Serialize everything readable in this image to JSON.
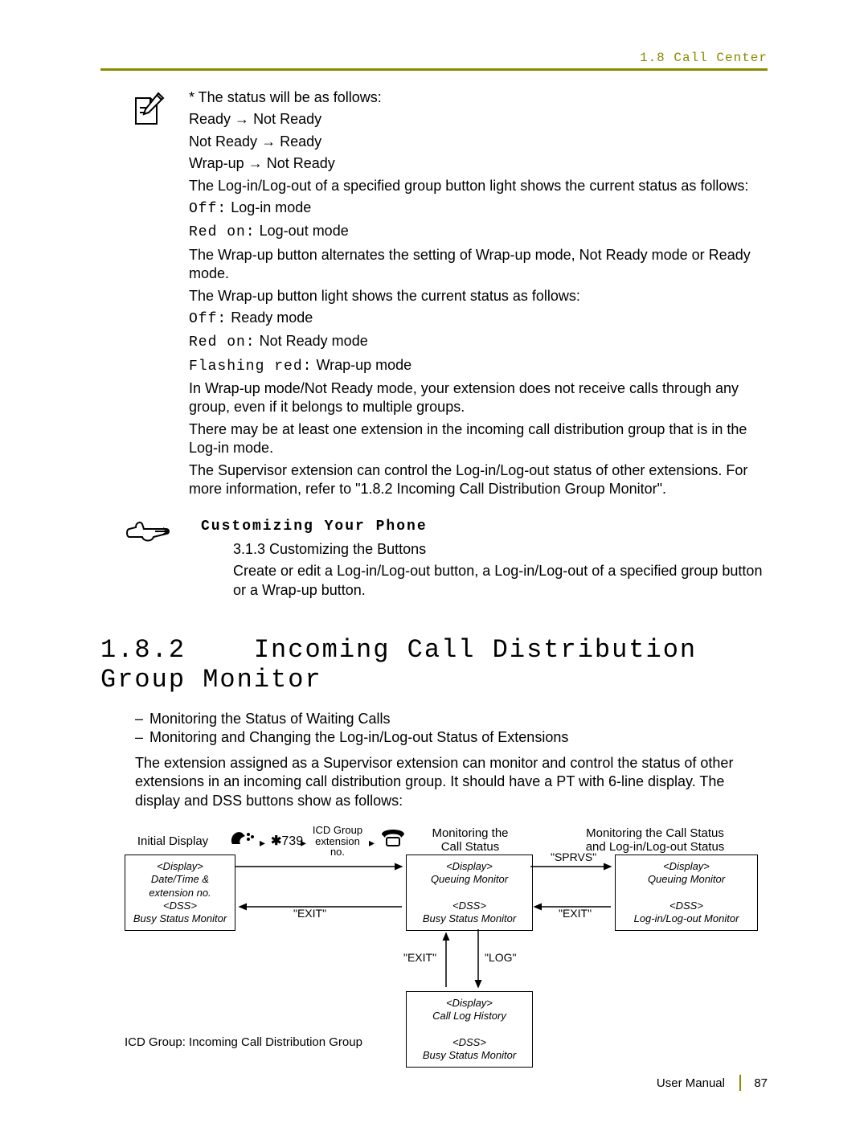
{
  "header": "1.8 Call Center",
  "note_block": {
    "status_intro": "* The status will be as follows:",
    "trans1_a": "Ready",
    "trans1_b": "Not Ready",
    "trans2_a": "Not Ready",
    "trans2_b": "Ready",
    "trans3_a": "Wrap-up",
    "trans3_b": "Not Ready",
    "p1": "The Log-in/Log-out of a specified group button light shows the current status as follows:",
    "off1_k": "Off:",
    "off1_v": "Log-in mode",
    "redon1_k": "Red on:",
    "redon1_v": "Log-out mode",
    "p2": "The Wrap-up button alternates the setting of Wrap-up mode, Not Ready mode or Ready mode.",
    "p3": "The Wrap-up button light shows the current status as follows:",
    "off2_k": "Off:",
    "off2_v": "Ready mode",
    "redon2_k": "Red on:",
    "redon2_v": "Not Ready mode",
    "flash_k": "Flashing red:",
    "flash_v": "Wrap-up mode",
    "p4": "In Wrap-up mode/Not Ready mode, your extension does not receive calls through any group, even if it belongs to multiple groups.",
    "p5": "There may be at least one extension in the incoming call distribution group that is in the Log-in mode.",
    "p6": "The Supervisor extension can control the Log-in/Log-out status of other extensions. For more information, refer to \"1.8.2 Incoming Call Distribution Group Monitor\"."
  },
  "custom": {
    "title": "Customizing Your Phone",
    "line1": "3.1.3 Customizing the Buttons",
    "line2": "Create or edit a Log-in/Log-out button, a Log-in/Log-out of a specified group button or a Wrap-up button."
  },
  "section": {
    "num": "1.8.2",
    "title": "Incoming Call Distribution Group Monitor",
    "bullets": [
      "Monitoring the Status of Waiting Calls",
      "Monitoring and Changing the Log-in/Log-out Status of Extensions"
    ],
    "para": "The extension assigned as a Supervisor extension can monitor and control the status of other extensions in an incoming call distribution group. It should have a PT with 6-line display. The display and DSS buttons show as follows:"
  },
  "flow": {
    "top": {
      "initial": "Initial Display",
      "code": "739",
      "ext": "ICD Group\nextension\nno.",
      "mid": "Monitoring the\nCall Status",
      "right": "Monitoring the Call Status\nand Log-in/Log-out Status"
    },
    "box_left": "<Display>\nDate/Time &\nextension no.\n<DSS>\nBusy Status Monitor",
    "box_mid": "<Display>\nQueuing Monitor\n\n<DSS>\nBusy Status Monitor",
    "box_right": "<Display>\nQueuing Monitor\n\n<DSS>\nLog-in/Log-out Monitor",
    "box_bottom": "<Display>\nCall Log History\n\n<DSS>\nBusy Status Monitor",
    "labels": {
      "sprvs": "\"SPRVS\"",
      "exit_left": "\"EXIT\"",
      "exit_right": "\"EXIT\"",
      "exit_down": "\"EXIT\"",
      "log": "\"LOG\""
    },
    "note": "ICD Group: Incoming Call Distribution Group"
  },
  "footer": {
    "label": "User Manual",
    "page": "87"
  }
}
